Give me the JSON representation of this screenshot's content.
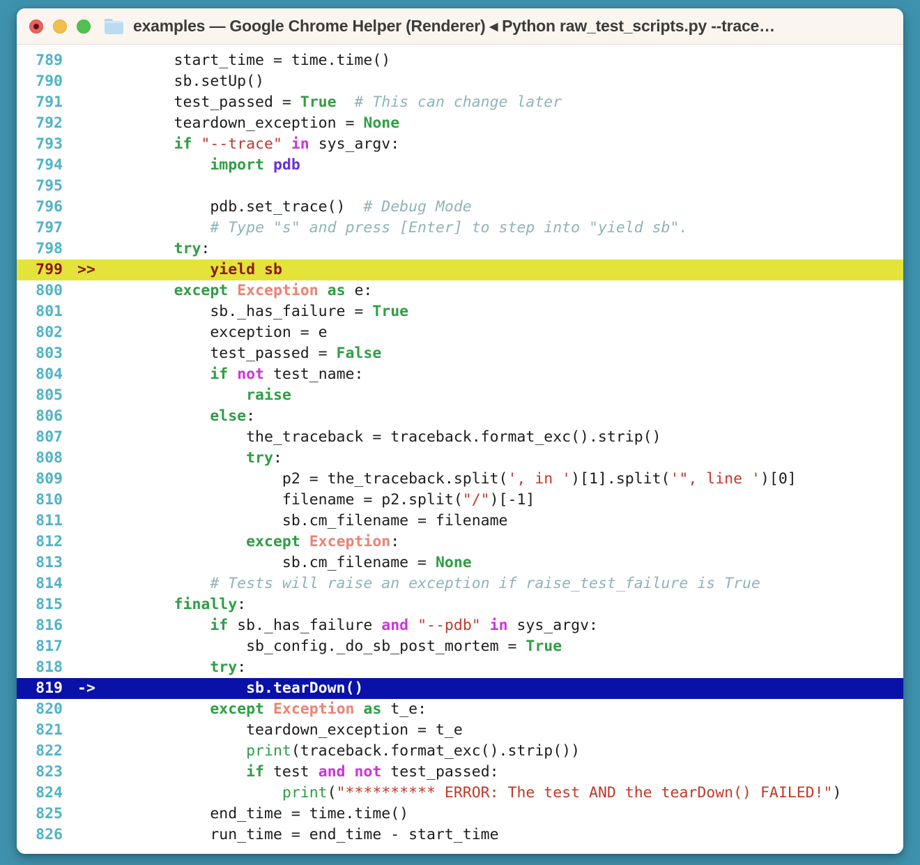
{
  "window": {
    "title": "examples — Google Chrome Helper (Renderer) ◂ Python raw_test_scripts.py --trace…",
    "traffic_lights": [
      {
        "name": "close-button",
        "color": "#e9635c"
      },
      {
        "name": "minimize-button",
        "color": "#f0bf4c"
      },
      {
        "name": "maximize-button",
        "color": "#4fc14f"
      }
    ],
    "folder_icon": "folder-icon",
    "colors": {
      "desktop": "#3f93af",
      "titlebar": "#faf5ef",
      "code_bg": "#ffffff",
      "lineno": "#4fb3c8",
      "highlight_current": "#e3e33a",
      "highlight_pointer": "#0a11a8",
      "keyword": "#2f9e44",
      "operator": "#cc33dd",
      "string": "#c0392b",
      "comment": "#8fb3b8",
      "exception": "#ed8274",
      "module": "#6a2fd6"
    }
  },
  "code": {
    "language": "python",
    "first_line": 789,
    "last_line": 826,
    "lines": [
      {
        "n": "789",
        "marker": "",
        "hl": "",
        "tokens": [
          {
            "t": "pln",
            "v": "        start_time = time.time()"
          }
        ]
      },
      {
        "n": "790",
        "marker": "",
        "hl": "",
        "tokens": [
          {
            "t": "pln",
            "v": "        sb.setUp()"
          }
        ]
      },
      {
        "n": "791",
        "marker": "",
        "hl": "",
        "tokens": [
          {
            "t": "pln",
            "v": "        test_passed = "
          },
          {
            "t": "kw",
            "v": "True"
          },
          {
            "t": "pln",
            "v": "  "
          },
          {
            "t": "com",
            "v": "# This can change later"
          }
        ]
      },
      {
        "n": "792",
        "marker": "",
        "hl": "",
        "tokens": [
          {
            "t": "pln",
            "v": "        teardown_exception = "
          },
          {
            "t": "kw",
            "v": "None"
          }
        ]
      },
      {
        "n": "793",
        "marker": "",
        "hl": "",
        "tokens": [
          {
            "t": "pln",
            "v": "        "
          },
          {
            "t": "kw",
            "v": "if"
          },
          {
            "t": "pln",
            "v": " "
          },
          {
            "t": "str",
            "v": "\"--trace\""
          },
          {
            "t": "pln",
            "v": " "
          },
          {
            "t": "op",
            "v": "in"
          },
          {
            "t": "pln",
            "v": " sys_argv:"
          }
        ]
      },
      {
        "n": "794",
        "marker": "",
        "hl": "",
        "tokens": [
          {
            "t": "pln",
            "v": "            "
          },
          {
            "t": "kw",
            "v": "import"
          },
          {
            "t": "pln",
            "v": " "
          },
          {
            "t": "mod",
            "v": "pdb"
          }
        ]
      },
      {
        "n": "795",
        "marker": "",
        "hl": "",
        "tokens": [
          {
            "t": "pln",
            "v": ""
          }
        ]
      },
      {
        "n": "796",
        "marker": "",
        "hl": "",
        "tokens": [
          {
            "t": "pln",
            "v": "            pdb.set_trace()  "
          },
          {
            "t": "com",
            "v": "# Debug Mode"
          }
        ]
      },
      {
        "n": "797",
        "marker": "",
        "hl": "",
        "tokens": [
          {
            "t": "pln",
            "v": "            "
          },
          {
            "t": "com",
            "v": "# Type \"s\" and press [Enter] to step into \"yield sb\"."
          }
        ]
      },
      {
        "n": "798",
        "marker": "",
        "hl": "",
        "tokens": [
          {
            "t": "pln",
            "v": "        "
          },
          {
            "t": "kw",
            "v": "try"
          },
          {
            "t": "pln",
            "v": ":"
          }
        ]
      },
      {
        "n": "799",
        "marker": ">>",
        "hl": "yellow",
        "tokens": [
          {
            "t": "pln",
            "v": "            "
          },
          {
            "t": "kw",
            "v": "yield"
          },
          {
            "t": "pln",
            "v": " sb"
          }
        ]
      },
      {
        "n": "800",
        "marker": "",
        "hl": "",
        "tokens": [
          {
            "t": "pln",
            "v": "        "
          },
          {
            "t": "kw",
            "v": "except"
          },
          {
            "t": "pln",
            "v": " "
          },
          {
            "t": "exc",
            "v": "Exception"
          },
          {
            "t": "pln",
            "v": " "
          },
          {
            "t": "kw",
            "v": "as"
          },
          {
            "t": "pln",
            "v": " e:"
          }
        ]
      },
      {
        "n": "801",
        "marker": "",
        "hl": "",
        "tokens": [
          {
            "t": "pln",
            "v": "            sb._has_failure = "
          },
          {
            "t": "kw",
            "v": "True"
          }
        ]
      },
      {
        "n": "802",
        "marker": "",
        "hl": "",
        "tokens": [
          {
            "t": "pln",
            "v": "            exception = e"
          }
        ]
      },
      {
        "n": "803",
        "marker": "",
        "hl": "",
        "tokens": [
          {
            "t": "pln",
            "v": "            test_passed = "
          },
          {
            "t": "kw",
            "v": "False"
          }
        ]
      },
      {
        "n": "804",
        "marker": "",
        "hl": "",
        "tokens": [
          {
            "t": "pln",
            "v": "            "
          },
          {
            "t": "kw",
            "v": "if"
          },
          {
            "t": "pln",
            "v": " "
          },
          {
            "t": "op",
            "v": "not"
          },
          {
            "t": "pln",
            "v": " test_name:"
          }
        ]
      },
      {
        "n": "805",
        "marker": "",
        "hl": "",
        "tokens": [
          {
            "t": "pln",
            "v": "                "
          },
          {
            "t": "kw",
            "v": "raise"
          }
        ]
      },
      {
        "n": "806",
        "marker": "",
        "hl": "",
        "tokens": [
          {
            "t": "pln",
            "v": "            "
          },
          {
            "t": "kw",
            "v": "else"
          },
          {
            "t": "pln",
            "v": ":"
          }
        ]
      },
      {
        "n": "807",
        "marker": "",
        "hl": "",
        "tokens": [
          {
            "t": "pln",
            "v": "                the_traceback = traceback.format_exc().strip()"
          }
        ]
      },
      {
        "n": "808",
        "marker": "",
        "hl": "",
        "tokens": [
          {
            "t": "pln",
            "v": "                "
          },
          {
            "t": "kw",
            "v": "try"
          },
          {
            "t": "pln",
            "v": ":"
          }
        ]
      },
      {
        "n": "809",
        "marker": "",
        "hl": "",
        "tokens": [
          {
            "t": "pln",
            "v": "                    p2 = the_traceback.split("
          },
          {
            "t": "str",
            "v": "', in '"
          },
          {
            "t": "pln",
            "v": ")[1].split("
          },
          {
            "t": "str",
            "v": "'\", line '"
          },
          {
            "t": "pln",
            "v": ")[0]"
          }
        ]
      },
      {
        "n": "810",
        "marker": "",
        "hl": "",
        "tokens": [
          {
            "t": "pln",
            "v": "                    filename = p2.split("
          },
          {
            "t": "str",
            "v": "\"/\""
          },
          {
            "t": "pln",
            "v": ")[-1]"
          }
        ]
      },
      {
        "n": "811",
        "marker": "",
        "hl": "",
        "tokens": [
          {
            "t": "pln",
            "v": "                    sb.cm_filename = filename"
          }
        ]
      },
      {
        "n": "812",
        "marker": "",
        "hl": "",
        "tokens": [
          {
            "t": "pln",
            "v": "                "
          },
          {
            "t": "kw",
            "v": "except"
          },
          {
            "t": "pln",
            "v": " "
          },
          {
            "t": "exc",
            "v": "Exception"
          },
          {
            "t": "pln",
            "v": ":"
          }
        ]
      },
      {
        "n": "813",
        "marker": "",
        "hl": "",
        "tokens": [
          {
            "t": "pln",
            "v": "                    sb.cm_filename = "
          },
          {
            "t": "kw",
            "v": "None"
          }
        ]
      },
      {
        "n": "814",
        "marker": "",
        "hl": "",
        "tokens": [
          {
            "t": "pln",
            "v": "            "
          },
          {
            "t": "com",
            "v": "# Tests will raise an exception if raise_test_failure is True"
          }
        ]
      },
      {
        "n": "815",
        "marker": "",
        "hl": "",
        "tokens": [
          {
            "t": "pln",
            "v": "        "
          },
          {
            "t": "kw",
            "v": "finally"
          },
          {
            "t": "pln",
            "v": ":"
          }
        ]
      },
      {
        "n": "816",
        "marker": "",
        "hl": "",
        "tokens": [
          {
            "t": "pln",
            "v": "            "
          },
          {
            "t": "kw",
            "v": "if"
          },
          {
            "t": "pln",
            "v": " sb._has_failure "
          },
          {
            "t": "op",
            "v": "and"
          },
          {
            "t": "pln",
            "v": " "
          },
          {
            "t": "str",
            "v": "\"--pdb\""
          },
          {
            "t": "pln",
            "v": " "
          },
          {
            "t": "op",
            "v": "in"
          },
          {
            "t": "pln",
            "v": " sys_argv:"
          }
        ]
      },
      {
        "n": "817",
        "marker": "",
        "hl": "",
        "tokens": [
          {
            "t": "pln",
            "v": "                sb_config._do_sb_post_mortem = "
          },
          {
            "t": "kw",
            "v": "True"
          }
        ]
      },
      {
        "n": "818",
        "marker": "",
        "hl": "",
        "tokens": [
          {
            "t": "pln",
            "v": "            "
          },
          {
            "t": "kw",
            "v": "try"
          },
          {
            "t": "pln",
            "v": ":"
          }
        ]
      },
      {
        "n": "819",
        "marker": "->",
        "hl": "blue",
        "tokens": [
          {
            "t": "pln",
            "v": "                sb.tearDown()"
          }
        ]
      },
      {
        "n": "820",
        "marker": "",
        "hl": "",
        "tokens": [
          {
            "t": "pln",
            "v": "            "
          },
          {
            "t": "kw",
            "v": "except"
          },
          {
            "t": "pln",
            "v": " "
          },
          {
            "t": "exc",
            "v": "Exception"
          },
          {
            "t": "pln",
            "v": " "
          },
          {
            "t": "kw",
            "v": "as"
          },
          {
            "t": "pln",
            "v": " t_e:"
          }
        ]
      },
      {
        "n": "821",
        "marker": "",
        "hl": "",
        "tokens": [
          {
            "t": "pln",
            "v": "                teardown_exception = t_e"
          }
        ]
      },
      {
        "n": "822",
        "marker": "",
        "hl": "",
        "tokens": [
          {
            "t": "pln",
            "v": "                "
          },
          {
            "t": "bif",
            "v": "print"
          },
          {
            "t": "pln",
            "v": "(traceback.format_exc().strip())"
          }
        ]
      },
      {
        "n": "823",
        "marker": "",
        "hl": "",
        "tokens": [
          {
            "t": "pln",
            "v": "                "
          },
          {
            "t": "kw",
            "v": "if"
          },
          {
            "t": "pln",
            "v": " test "
          },
          {
            "t": "op",
            "v": "and"
          },
          {
            "t": "pln",
            "v": " "
          },
          {
            "t": "op",
            "v": "not"
          },
          {
            "t": "pln",
            "v": " test_passed:"
          }
        ]
      },
      {
        "n": "824",
        "marker": "",
        "hl": "",
        "tokens": [
          {
            "t": "pln",
            "v": "                    "
          },
          {
            "t": "bif",
            "v": "print"
          },
          {
            "t": "pln",
            "v": "("
          },
          {
            "t": "str",
            "v": "\"********** ERROR: The test AND the tearDown() FAILED!\""
          },
          {
            "t": "pln",
            "v": ")"
          }
        ]
      },
      {
        "n": "825",
        "marker": "",
        "hl": "",
        "tokens": [
          {
            "t": "pln",
            "v": "            end_time = time.time()"
          }
        ]
      },
      {
        "n": "826",
        "marker": "",
        "hl": "",
        "tokens": [
          {
            "t": "pln",
            "v": "            run_time = end_time - start_time"
          }
        ]
      }
    ]
  }
}
